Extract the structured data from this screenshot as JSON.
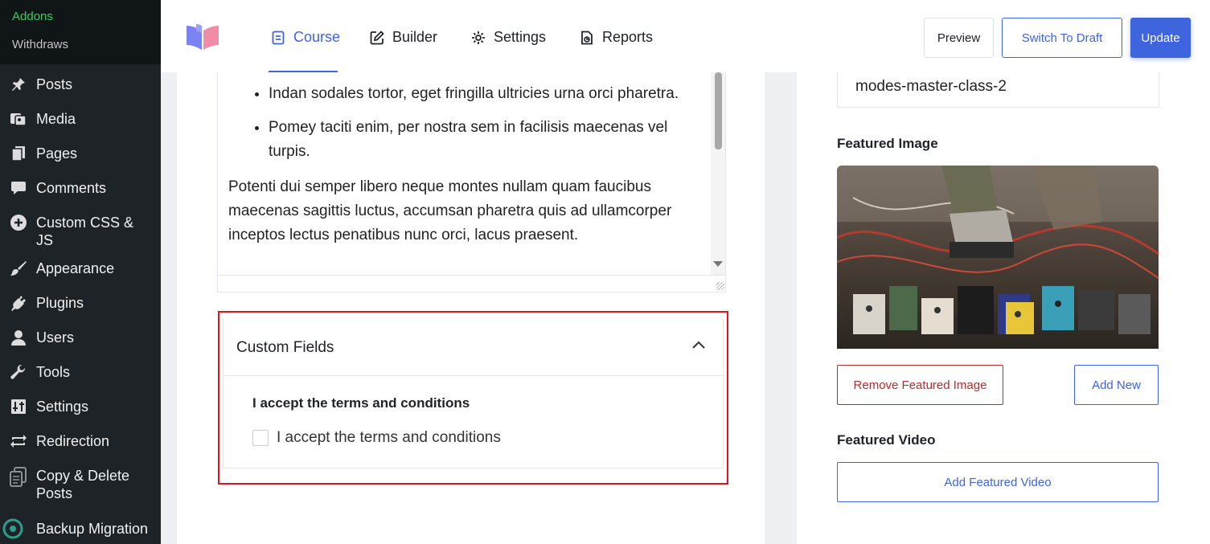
{
  "wp_sidebar": {
    "submenu": [
      {
        "label": "Addons",
        "active": true
      },
      {
        "label": "Withdraws",
        "active": false
      }
    ],
    "menu": [
      {
        "label": "Posts",
        "icon": "pin-icon"
      },
      {
        "label": "Media",
        "icon": "media-icon"
      },
      {
        "label": "Pages",
        "icon": "pages-icon"
      },
      {
        "label": "Comments",
        "icon": "comment-icon"
      },
      {
        "label": "Custom CSS & JS",
        "icon": "plus-circle-icon"
      },
      {
        "label": "Appearance",
        "icon": "brush-icon"
      },
      {
        "label": "Plugins",
        "icon": "plug-icon"
      },
      {
        "label": "Users",
        "icon": "user-icon"
      },
      {
        "label": "Tools",
        "icon": "wrench-icon"
      },
      {
        "label": "Settings",
        "icon": "sliders-icon"
      },
      {
        "label": "Redirection",
        "icon": "redirect-icon"
      },
      {
        "label": "Copy & Delete Posts",
        "icon": "copy-icon"
      },
      {
        "label": "Backup Migration",
        "icon": "backup-icon"
      }
    ]
  },
  "topbar": {
    "tabs": [
      {
        "label": "Course",
        "icon": "document-icon",
        "active": true
      },
      {
        "label": "Builder",
        "icon": "edit-icon",
        "active": false
      },
      {
        "label": "Settings",
        "icon": "gear-icon",
        "active": false
      },
      {
        "label": "Reports",
        "icon": "report-icon",
        "active": false
      }
    ],
    "preview_label": "Preview",
    "draft_label": "Switch To Draft",
    "update_label": "Update"
  },
  "editor": {
    "bullets": [
      "Indan sodales tortor, eget fringilla ultricies urna orci pharetra.",
      "Pomey taciti enim, per nostra sem in facilisis maecenas vel turpis."
    ],
    "paragraph": "Potenti dui semper libero neque montes nullam quam faucibus maecenas sagittis luctus, accumsan pharetra quis ad ullamcorper inceptos lectus penatibus nunc orci, lacus praesent."
  },
  "custom_fields": {
    "title": "Custom Fields",
    "field_label": "I accept the terms and conditions",
    "checkbox_label": "I accept the terms and conditions",
    "checked": false
  },
  "right_panel": {
    "slug_value": "modes-master-class-2",
    "featured_image_label": "Featured Image",
    "remove_image_label": "Remove Featured Image",
    "add_new_label": "Add New",
    "featured_video_label": "Featured Video",
    "add_video_label": "Add Featured Video"
  },
  "colors": {
    "accent": "#3e64de",
    "sidebar_bg": "#1d2327",
    "highlight": "#e0141e",
    "danger": "#b32d2e"
  }
}
